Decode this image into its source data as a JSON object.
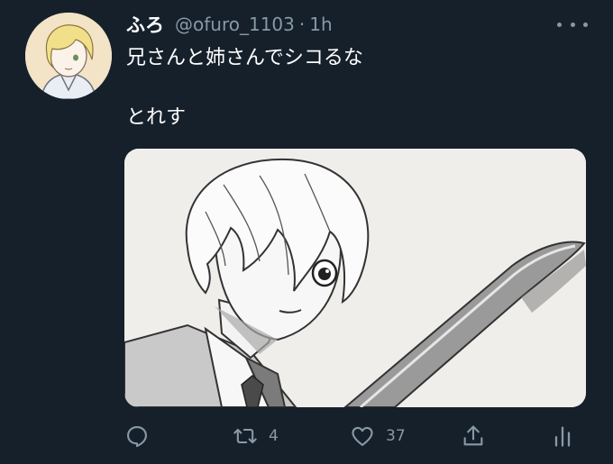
{
  "tweet": {
    "display_name": "ふろ",
    "handle": "@ofuro_1103",
    "separator": "·",
    "time": "1h",
    "text": "兄さんと姉さんでシコるな\n\nとれす",
    "icons": {
      "avatar": "user-avatar",
      "more": "more-options-icon",
      "media": "drawing-image"
    }
  },
  "actions": {
    "reply": {
      "icon": "reply-icon",
      "count": ""
    },
    "retweet": {
      "icon": "retweet-icon",
      "count": "4"
    },
    "like": {
      "icon": "heart-icon",
      "count": "37"
    },
    "share": {
      "icon": "share-icon"
    },
    "analytics": {
      "icon": "analytics-icon"
    }
  },
  "colors": {
    "background": "#15202b",
    "text": "#ffffff",
    "secondary": "#8899a6",
    "media_background": "#efeeea"
  }
}
